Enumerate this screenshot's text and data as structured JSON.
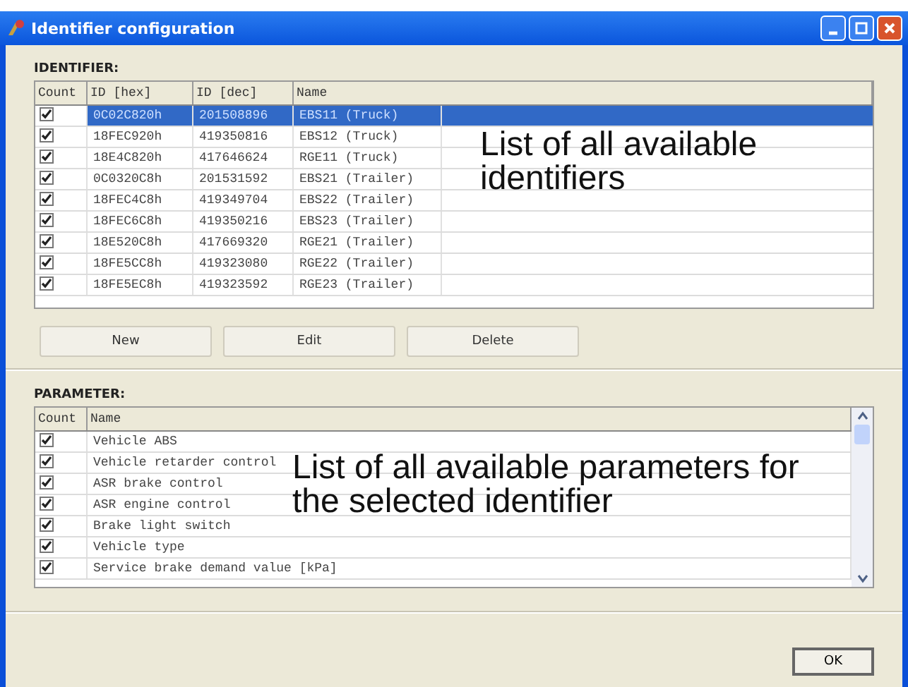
{
  "window": {
    "title": "Identifier configuration"
  },
  "identifier": {
    "label": "IDENTIFIER:",
    "check_column": "Count",
    "columns": [
      "ID [hex]",
      "ID [dec]",
      "Name"
    ],
    "rows": [
      {
        "checked": true,
        "selected": true,
        "cells": [
          "0C02C820h",
          "201508896",
          "EBS11 (Truck)"
        ]
      },
      {
        "checked": true,
        "selected": false,
        "cells": [
          "18FEC920h",
          "419350816",
          "EBS12 (Truck)"
        ]
      },
      {
        "checked": true,
        "selected": false,
        "cells": [
          "18E4C820h",
          "417646624",
          "RGE11 (Truck)"
        ]
      },
      {
        "checked": true,
        "selected": false,
        "cells": [
          "0C0320C8h",
          "201531592",
          "EBS21 (Trailer)"
        ]
      },
      {
        "checked": true,
        "selected": false,
        "cells": [
          "18FEC4C8h",
          "419349704",
          "EBS22 (Trailer)"
        ]
      },
      {
        "checked": true,
        "selected": false,
        "cells": [
          "18FEC6C8h",
          "419350216",
          "EBS23 (Trailer)"
        ]
      },
      {
        "checked": true,
        "selected": false,
        "cells": [
          "18E520C8h",
          "417669320",
          "RGE21 (Trailer)"
        ]
      },
      {
        "checked": true,
        "selected": false,
        "cells": [
          "18FE5CC8h",
          "419323080",
          "RGE22 (Trailer)"
        ]
      },
      {
        "checked": true,
        "selected": false,
        "cells": [
          "18FE5EC8h",
          "419323592",
          "RGE23 (Trailer)"
        ]
      }
    ],
    "annotation": "List of all available identifiers"
  },
  "buttons": [
    "New",
    "Edit",
    "Delete"
  ],
  "parameter": {
    "label": "PARAMETER:",
    "check_column": "Count",
    "columns": [
      "Name"
    ],
    "rows": [
      {
        "checked": true,
        "name": "Vehicle ABS"
      },
      {
        "checked": true,
        "name": "Vehicle retarder control"
      },
      {
        "checked": true,
        "name": "ASR brake control"
      },
      {
        "checked": true,
        "name": "ASR engine control"
      },
      {
        "checked": true,
        "name": "Brake light switch"
      },
      {
        "checked": true,
        "name": "Vehicle type"
      },
      {
        "checked": true,
        "name": "Service brake demand value [kPa]"
      }
    ],
    "annotation": "List of all available parameters for the selected identifier"
  },
  "ok_button": "OK"
}
